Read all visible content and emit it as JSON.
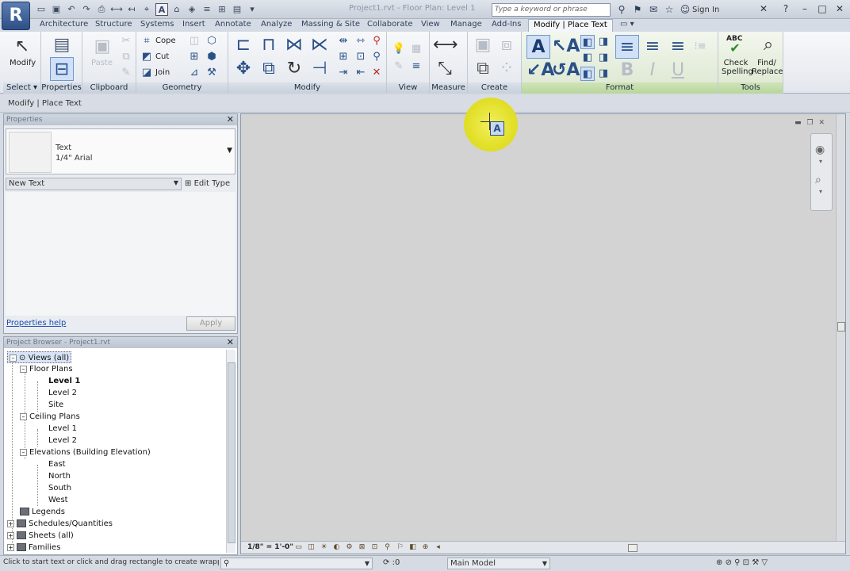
{
  "app": {
    "logo": "R",
    "doc_title": "Project1.rvt - Floor Plan: Level 1",
    "search_placeholder": "Type a keyword or phrase",
    "sign_in": "Sign In"
  },
  "tabs": [
    {
      "label": "Architecture"
    },
    {
      "label": "Structure"
    },
    {
      "label": "Systems"
    },
    {
      "label": "Insert"
    },
    {
      "label": "Annotate"
    },
    {
      "label": "Analyze"
    },
    {
      "label": "Massing & Site"
    },
    {
      "label": "Collaborate"
    },
    {
      "label": "View"
    },
    {
      "label": "Manage"
    },
    {
      "label": "Add-Ins"
    },
    {
      "label": "Modify | Place Text"
    }
  ],
  "ribbon": {
    "modify_label": "Modify",
    "paste_label": "Paste",
    "cope_label": "Cope",
    "cut_label": "Cut",
    "join_label": "Join",
    "check_spelling_label": "Check Spelling",
    "check_spelling_line1": "Check",
    "check_spelling_line2": "Spelling",
    "find_replace_line1": "Find/",
    "find_replace_line2": "Replace",
    "abc_label": "ABC",
    "panels": {
      "select": "Select",
      "properties": "Properties",
      "clipboard": "Clipboard",
      "geometry": "Geometry",
      "modify": "Modify",
      "view": "View",
      "measure": "Measure",
      "create": "Create",
      "format": "Format",
      "tools": "Tools"
    }
  },
  "optionsbar": {
    "breadcrumb": "Modify | Place Text"
  },
  "properties": {
    "title": "Properties",
    "type_name": "Text",
    "type_sub": "1/4\" Arial",
    "instance_selector": "New Text",
    "edit_type": "Edit Type",
    "help_link": "Properties help",
    "apply": "Apply"
  },
  "browser": {
    "title": "Project Browser - Project1.rvt",
    "nodes": [
      {
        "label": "Views (all)"
      },
      {
        "label": "Floor Plans"
      },
      {
        "label": "Level 1"
      },
      {
        "label": "Level 2"
      },
      {
        "label": "Site"
      },
      {
        "label": "Ceiling Plans"
      },
      {
        "label": "Level 1"
      },
      {
        "label": "Level 2"
      },
      {
        "label": "Elevations (Building Elevation)"
      },
      {
        "label": "East"
      },
      {
        "label": "North"
      },
      {
        "label": "South"
      },
      {
        "label": "West"
      },
      {
        "label": "Legends"
      },
      {
        "label": "Schedules/Quantities"
      },
      {
        "label": "Sheets (all)"
      },
      {
        "label": "Families"
      }
    ]
  },
  "viewcontrol": {
    "scale": "1/8\" = 1'-0\""
  },
  "status": {
    "message": "Click to start text or click and drag rectangle to create wrapping text.",
    "worksets_value": ":0",
    "design_option": "Main Model"
  },
  "colors": {
    "accent": "#2a5088",
    "context_tab": "#b8d69b",
    "highlight": "#e3e020"
  }
}
